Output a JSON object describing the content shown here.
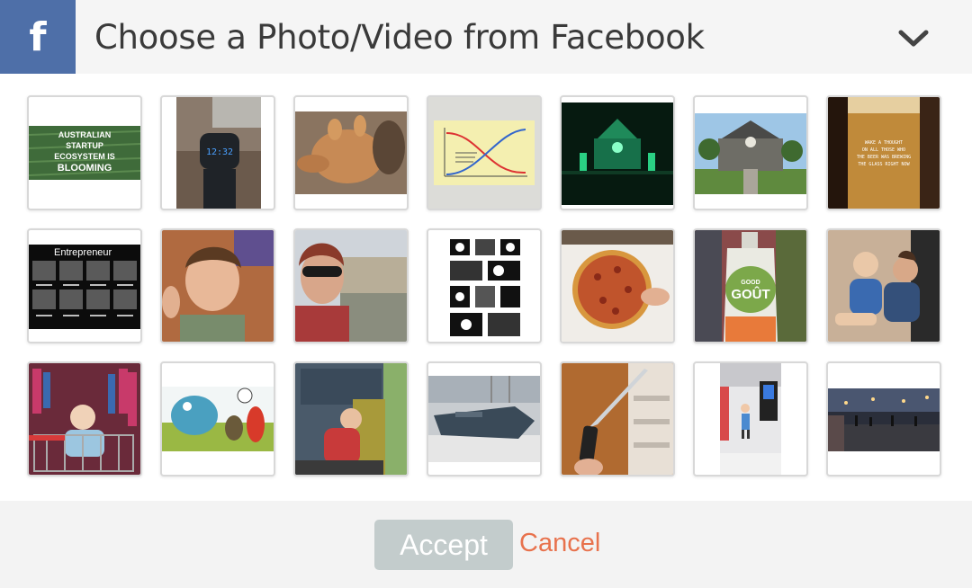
{
  "header": {
    "logo_letter": "f",
    "title": "Choose a Photo/Video from Facebook",
    "brand_color": "#4e6fa8",
    "collapse_icon": "chevron-down-icon"
  },
  "grid": {
    "rows": [
      [
        {
          "name": "photo-australian-startup",
          "text": [
            "AUSTRALIAN",
            "STARTUP",
            "ECOSYSTEM IS",
            "BLOOMING"
          ]
        },
        {
          "name": "photo-wristwatch",
          "text": [
            "12:32"
          ]
        },
        {
          "name": "photo-alien-creature",
          "text": []
        },
        {
          "name": "photo-chart-sketch",
          "text": []
        },
        {
          "name": "photo-green-house-night",
          "text": []
        },
        {
          "name": "photo-monster-house",
          "text": []
        },
        {
          "name": "photo-beer-glass",
          "text": [
            "WAKE A THOUGHT",
            "ON ALL THOSE WHO",
            "THE BEER WAS BREWING",
            "THE GLASS RIGHT NOW"
          ]
        }
      ],
      [
        {
          "name": "photo-entrepreneur",
          "text": [
            "Entrepreneur"
          ]
        },
        {
          "name": "photo-boy-selfie",
          "text": []
        },
        {
          "name": "photo-woman-sunglasses",
          "text": []
        },
        {
          "name": "photo-comic-strip",
          "text": []
        },
        {
          "name": "photo-pizza",
          "text": []
        },
        {
          "name": "photo-good-gout-pouch",
          "text": [
            "GOOD",
            "GOÛT"
          ]
        },
        {
          "name": "photo-children-hug",
          "text": []
        }
      ],
      [
        {
          "name": "photo-baby-trolley",
          "text": []
        },
        {
          "name": "photo-cartoon-frog",
          "text": []
        },
        {
          "name": "photo-toddler-playground",
          "text": []
        },
        {
          "name": "photo-jet-ski",
          "text": []
        },
        {
          "name": "photo-knife",
          "text": []
        },
        {
          "name": "photo-child-store",
          "text": []
        },
        {
          "name": "photo-night-plaza",
          "text": []
        }
      ]
    ]
  },
  "footer": {
    "accept_label": "Accept",
    "cancel_label": "Cancel",
    "accept_color": "#c3cccc",
    "cancel_color": "#e8724d"
  }
}
